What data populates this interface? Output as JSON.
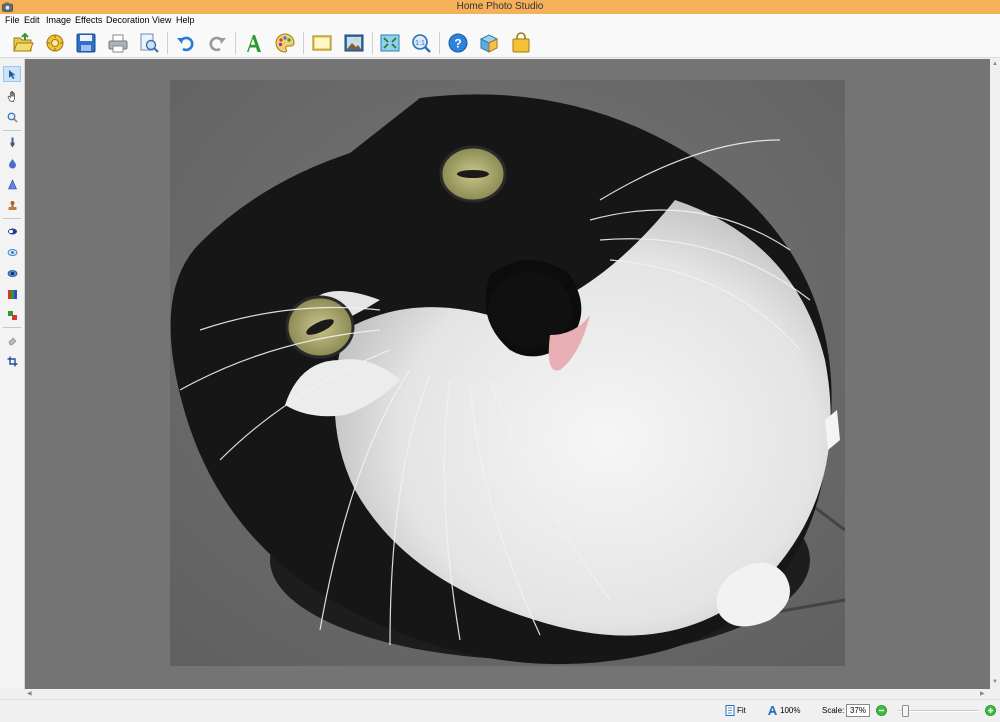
{
  "window": {
    "title": "Home Photo Studio"
  },
  "menu": [
    "File",
    "Edit",
    "Image",
    "Effects",
    "Decoration",
    "View",
    "Help"
  ],
  "toolbar": [
    "open-folder-icon",
    "scanner-icon",
    "save-icon",
    "print-icon",
    "print-preview-icon",
    "undo-icon",
    "redo-icon",
    "text-icon",
    "palette-icon",
    "image-icon",
    "photo-frame-icon",
    "fit-window-icon",
    "actual-size-icon",
    "help-icon",
    "box-icon",
    "shopping-bag-icon"
  ],
  "left_tools": [
    "pointer-icon",
    "hand-icon",
    "zoom-icon",
    "brush-icon",
    "drop-icon",
    "cone-icon",
    "stamp-icon",
    "mask-icon",
    "eye-icon",
    "red-eye-icon",
    "color-bars-icon",
    "color-replace-icon",
    "eraser-icon",
    "crop-icon"
  ],
  "status": {
    "fit_label": "Fit",
    "actual_label": "100%",
    "scale_label": "Scale:",
    "scale_value": "37%",
    "zoom_level": 0.05
  },
  "colors": {
    "titlebar": "#f5b05a",
    "canvas": "#747474",
    "accent": "#2a7bd6"
  }
}
